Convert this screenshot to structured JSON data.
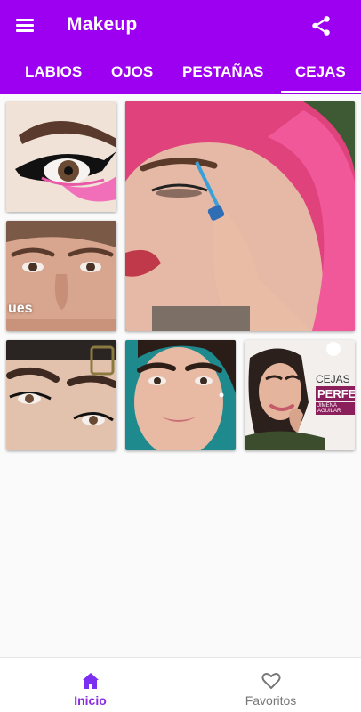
{
  "app": {
    "title": "Makeup",
    "accent_color": "#9d00f0"
  },
  "toolbar": {
    "menu_icon": "hamburger-menu-icon",
    "share_icon": "share-icon"
  },
  "tabs": [
    {
      "label": "LABIOS",
      "selected": false
    },
    {
      "label": "OJOS",
      "selected": false
    },
    {
      "label": "PESTAÑAS",
      "selected": false
    },
    {
      "label": "CEJAS",
      "selected": true
    }
  ],
  "grid": {
    "tiles": [
      {
        "name": "tile-eyeliner-pink"
      },
      {
        "name": "tile-eyebrow-pencil-pink-hair"
      },
      {
        "name": "tile-face-closeup",
        "caption": "ues"
      },
      {
        "name": "tile-eyebrows-headband"
      },
      {
        "name": "tile-eyebrows-model"
      },
      {
        "name": "tile-cejas-perfectas",
        "caption_1": "CEJAS",
        "caption_2": "PERFECTAS",
        "caption_3": "JIMENA AGUILAR"
      }
    ]
  },
  "bottom_nav": {
    "items": [
      {
        "label": "Inicio",
        "icon": "home-icon",
        "active": true
      },
      {
        "label": "Favoritos",
        "icon": "heart-icon",
        "active": false
      }
    ]
  }
}
